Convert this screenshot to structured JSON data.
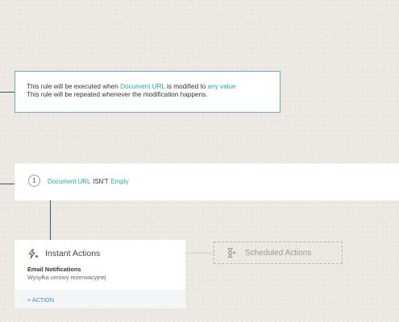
{
  "rule_info": {
    "line1_prefix": "This rule will be executed when",
    "line1_field": "Document URL",
    "line1_middle": "is modified to",
    "line1_value": "any value",
    "line2": "This rule will be repeated whenever the modification happens."
  },
  "criteria": {
    "number": "1",
    "field": "Document URL",
    "operator": "ISN'T",
    "value": "Empty"
  },
  "instant_actions": {
    "title": "Instant Actions",
    "icon": "lightning-bolt-icon",
    "email_title": "Email Notifications",
    "email_subtitle": "Wysyłka umowy rezerwacyjnej",
    "add_action_label": "+ ACTION"
  },
  "scheduled_actions": {
    "title": "Scheduled Actions",
    "icon": "hourglass-add-icon"
  },
  "colors": {
    "accent_teal": "#27a9a2",
    "action_blue": "#3a8bd6",
    "connector_navy": "#3a5473",
    "info_border": "#6fa6c6"
  }
}
